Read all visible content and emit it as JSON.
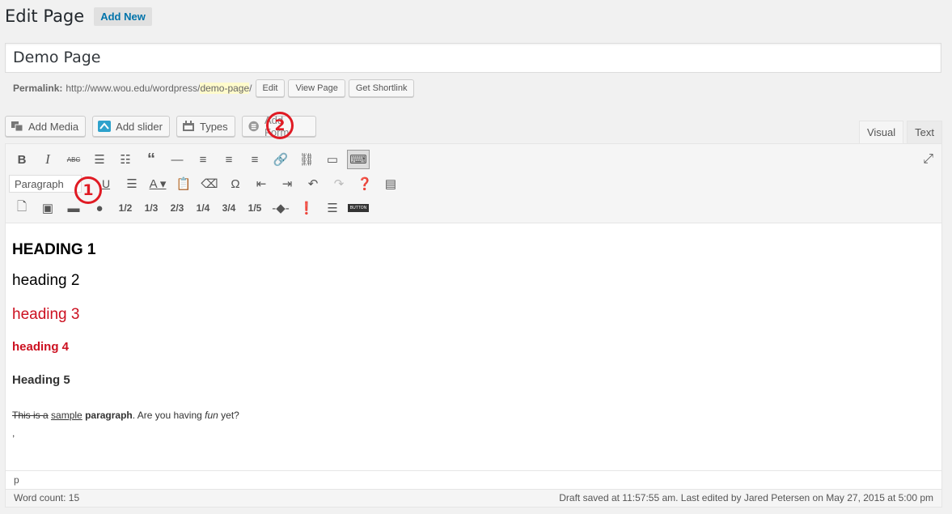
{
  "header": {
    "title": "Edit Page",
    "add_new": "Add New"
  },
  "post_title": "Demo Page",
  "permalink": {
    "label": "Permalink:",
    "base": "http://www.wou.edu/wordpress/",
    "slug": "demo-page",
    "trail": "/",
    "edit": "Edit",
    "view": "View Page",
    "shortlink": "Get Shortlink"
  },
  "media_buttons": {
    "add_media": "Add Media",
    "add_slider": "Add slider",
    "types": "Types",
    "add_form": "Add Form"
  },
  "tabs": {
    "visual": "Visual",
    "text": "Text"
  },
  "toolbar": {
    "format_select": "Paragraph",
    "col_1_2": "1/2",
    "col_1_3": "1/3",
    "col_2_3": "2/3",
    "col_1_4": "1/4",
    "col_3_4": "3/4",
    "col_1_5": "1/5"
  },
  "content": {
    "h1": "HEADING 1",
    "h2": "heading 2",
    "h3": "heading 3",
    "h4": "heading 4",
    "h5": "Heading 5",
    "para_strike": "This is a",
    "para_under": "sample",
    "para_bold": "paragraph",
    "para_mid": ". Are you having ",
    "para_italic": "fun",
    "para_end": " yet?",
    "comma": ","
  },
  "path_bar": "p",
  "status": {
    "word_count": "Word count: 15",
    "draft_saved": "Draft saved at 11:57:55 am. Last edited by Jared Petersen on May 27, 2015 at 5:00 pm"
  },
  "callouts": {
    "one": "1",
    "two": "2"
  },
  "colors": {
    "accent": "#0073aa",
    "callout": "#e01b24",
    "heading_red": "#cc1020"
  }
}
